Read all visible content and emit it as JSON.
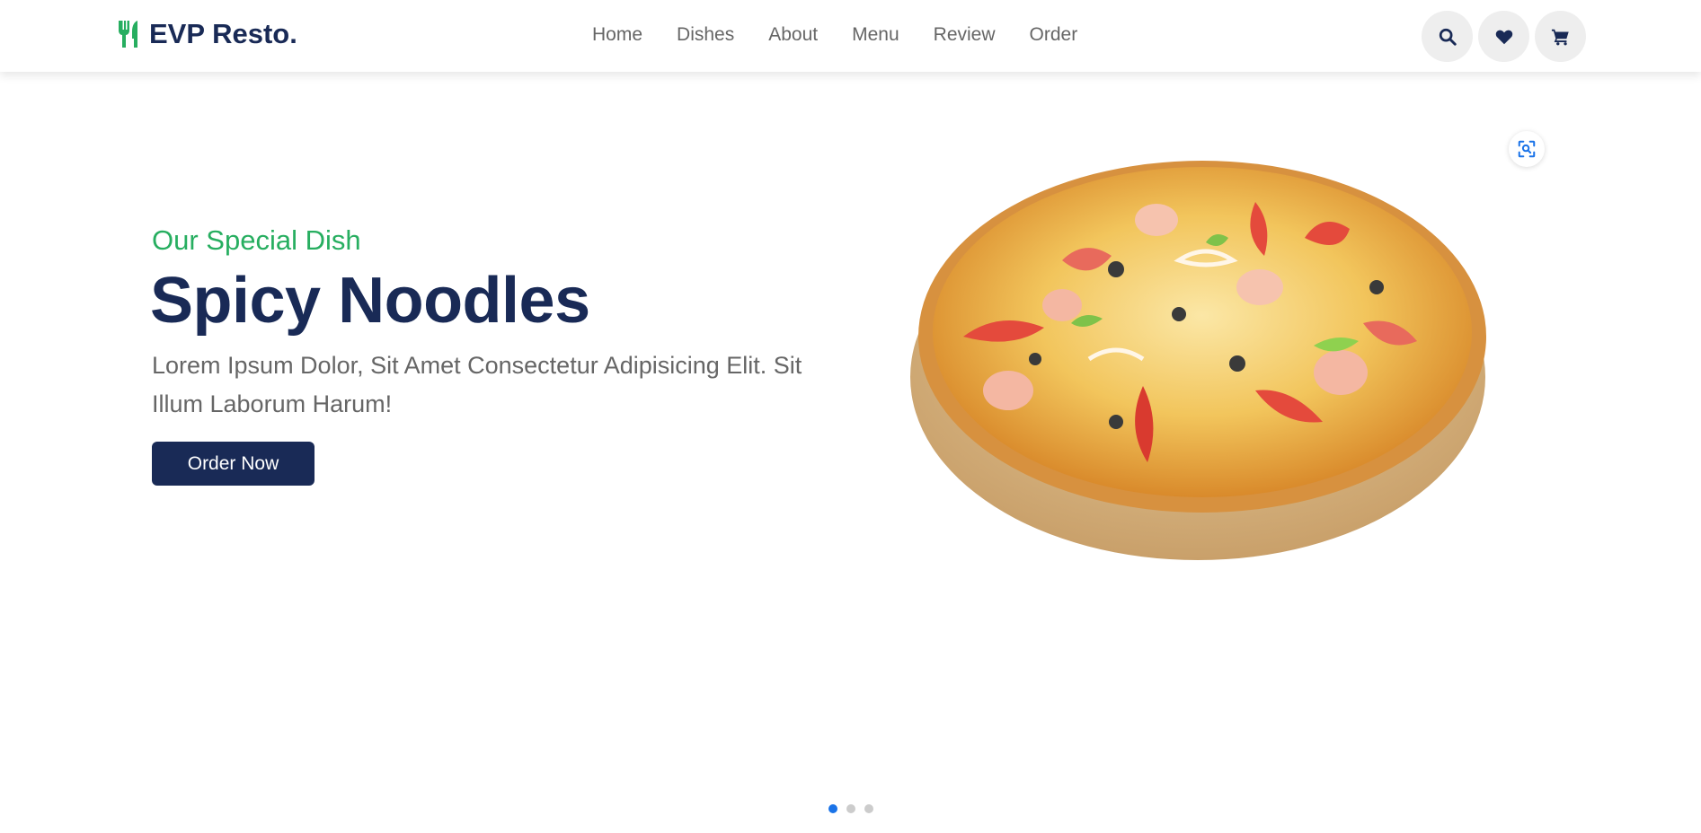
{
  "brand": {
    "name": "EVP Resto.",
    "icon": "utensils-icon",
    "icon_color": "#27ae60",
    "color": "#192a56"
  },
  "nav": {
    "items": [
      {
        "label": "Home"
      },
      {
        "label": "Dishes"
      },
      {
        "label": "About"
      },
      {
        "label": "Menu"
      },
      {
        "label": "Review"
      },
      {
        "label": "Order"
      }
    ]
  },
  "header_icons": [
    "search-icon",
    "heart-icon",
    "cart-icon"
  ],
  "hero": {
    "subtitle": "Our Special Dish",
    "title": "Spicy Noodles",
    "description": "Lorem Ipsum Dolor, Sit Amet Consectetur Adipisicing Elit. Sit Illum Laborum Harum!",
    "button_label": "Order Now",
    "image_icon": "pizza-image",
    "lens_icon": "visual-search-icon"
  },
  "slider": {
    "count": 3,
    "active_index": 0
  },
  "colors": {
    "accent": "#27ae60",
    "primary": "#192a56",
    "text": "#666666",
    "dot_active": "#1a73e8"
  }
}
